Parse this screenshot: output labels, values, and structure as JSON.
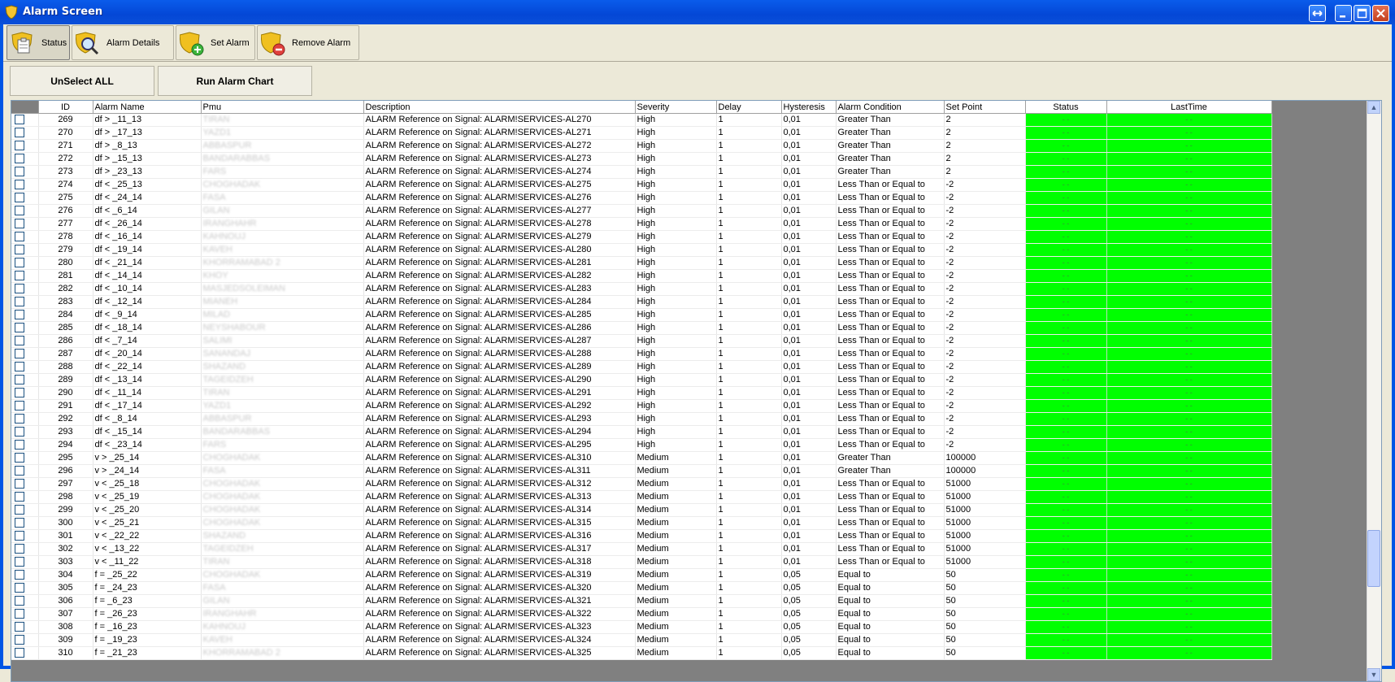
{
  "window": {
    "title": "Alarm Screen"
  },
  "toolbar": {
    "status": "Status",
    "alarm_details": "Alarm Details",
    "set_alarm": "Set Alarm",
    "remove_alarm": "Remove Alarm"
  },
  "buttons": {
    "unselect_all": "UnSelect ALL",
    "run_alarm_chart": "Run Alarm Chart"
  },
  "grid": {
    "columns": {
      "id": "ID",
      "alarm_name": "Alarm Name",
      "pmu": "Pmu",
      "description": "Description",
      "severity": "Severity",
      "delay": "Delay",
      "hysteresis": "Hysteresis",
      "alarm_condition": "Alarm Condition",
      "set_point": "Set Point",
      "status": "Status",
      "last_time": "LastTime"
    },
    "status_color": "#00FF00",
    "rows": [
      {
        "id": "269",
        "name": "df > _11_13",
        "pmu": "TIRAN",
        "desc": "ALARM Reference on Signal: ALARM!SERVICES-AL270",
        "sev": "High",
        "delay": "1",
        "hyst": "0,01",
        "cond": "Greater Than",
        "sp": "2",
        "status": "- -",
        "last": "- -"
      },
      {
        "id": "270",
        "name": "df > _17_13",
        "pmu": "YAZD1",
        "desc": "ALARM Reference on Signal: ALARM!SERVICES-AL271",
        "sev": "High",
        "delay": "1",
        "hyst": "0,01",
        "cond": "Greater Than",
        "sp": "2",
        "status": "- -",
        "last": "- -"
      },
      {
        "id": "271",
        "name": "df > _8_13",
        "pmu": "ABBASPUR",
        "desc": "ALARM Reference on Signal: ALARM!SERVICES-AL272",
        "sev": "High",
        "delay": "1",
        "hyst": "0,01",
        "cond": "Greater Than",
        "sp": "2",
        "status": "- -",
        "last": "- -"
      },
      {
        "id": "272",
        "name": "df > _15_13",
        "pmu": "BANDARABBAS",
        "desc": "ALARM Reference on Signal: ALARM!SERVICES-AL273",
        "sev": "High",
        "delay": "1",
        "hyst": "0,01",
        "cond": "Greater Than",
        "sp": "2",
        "status": "- -",
        "last": "- -"
      },
      {
        "id": "273",
        "name": "df > _23_13",
        "pmu": "FARS",
        "desc": "ALARM Reference on Signal: ALARM!SERVICES-AL274",
        "sev": "High",
        "delay": "1",
        "hyst": "0,01",
        "cond": "Greater Than",
        "sp": "2",
        "status": "- -",
        "last": "- -"
      },
      {
        "id": "274",
        "name": "df < _25_13",
        "pmu": "CHOGHADAK",
        "desc": "ALARM Reference on Signal: ALARM!SERVICES-AL275",
        "sev": "High",
        "delay": "1",
        "hyst": "0,01",
        "cond": "Less Than or Equal to",
        "sp": "-2",
        "status": "- -",
        "last": "- -"
      },
      {
        "id": "275",
        "name": "df < _24_14",
        "pmu": "FASA",
        "desc": "ALARM Reference on Signal: ALARM!SERVICES-AL276",
        "sev": "High",
        "delay": "1",
        "hyst": "0,01",
        "cond": "Less Than or Equal to",
        "sp": "-2",
        "status": "- -",
        "last": "- -"
      },
      {
        "id": "276",
        "name": "df < _6_14",
        "pmu": "GILAN",
        "desc": "ALARM Reference on Signal: ALARM!SERVICES-AL277",
        "sev": "High",
        "delay": "1",
        "hyst": "0,01",
        "cond": "Less Than or Equal to",
        "sp": "-2",
        "status": "- -",
        "last": "- -"
      },
      {
        "id": "277",
        "name": "df < _26_14",
        "pmu": "IRANGHAHR",
        "desc": "ALARM Reference on Signal: ALARM!SERVICES-AL278",
        "sev": "High",
        "delay": "1",
        "hyst": "0,01",
        "cond": "Less Than or Equal to",
        "sp": "-2",
        "status": "- -",
        "last": "- -"
      },
      {
        "id": "278",
        "name": "df < _16_14",
        "pmu": "KAHNOUJ",
        "desc": "ALARM Reference on Signal: ALARM!SERVICES-AL279",
        "sev": "High",
        "delay": "1",
        "hyst": "0,01",
        "cond": "Less Than or Equal to",
        "sp": "-2",
        "status": "- -",
        "last": "- -"
      },
      {
        "id": "279",
        "name": "df < _19_14",
        "pmu": "KAVEH",
        "desc": "ALARM Reference on Signal: ALARM!SERVICES-AL280",
        "sev": "High",
        "delay": "1",
        "hyst": "0,01",
        "cond": "Less Than or Equal to",
        "sp": "-2",
        "status": "- -",
        "last": "- -"
      },
      {
        "id": "280",
        "name": "df < _21_14",
        "pmu": "KHORRAMABAD 2",
        "desc": "ALARM Reference on Signal: ALARM!SERVICES-AL281",
        "sev": "High",
        "delay": "1",
        "hyst": "0,01",
        "cond": "Less Than or Equal to",
        "sp": "-2",
        "status": "- -",
        "last": "- -"
      },
      {
        "id": "281",
        "name": "df < _14_14",
        "pmu": "KHOY",
        "desc": "ALARM Reference on Signal: ALARM!SERVICES-AL282",
        "sev": "High",
        "delay": "1",
        "hyst": "0,01",
        "cond": "Less Than or Equal to",
        "sp": "-2",
        "status": "- -",
        "last": "- -"
      },
      {
        "id": "282",
        "name": "df < _10_14",
        "pmu": "MASJEDSOLEIMAN",
        "desc": "ALARM Reference on Signal: ALARM!SERVICES-AL283",
        "sev": "High",
        "delay": "1",
        "hyst": "0,01",
        "cond": "Less Than or Equal to",
        "sp": "-2",
        "status": "- -",
        "last": "- -"
      },
      {
        "id": "283",
        "name": "df < _12_14",
        "pmu": "MIANEH",
        "desc": "ALARM Reference on Signal: ALARM!SERVICES-AL284",
        "sev": "High",
        "delay": "1",
        "hyst": "0,01",
        "cond": "Less Than or Equal to",
        "sp": "-2",
        "status": "- -",
        "last": "- -"
      },
      {
        "id": "284",
        "name": "df < _9_14",
        "pmu": "MILAD",
        "desc": "ALARM Reference on Signal: ALARM!SERVICES-AL285",
        "sev": "High",
        "delay": "1",
        "hyst": "0,01",
        "cond": "Less Than or Equal to",
        "sp": "-2",
        "status": "- -",
        "last": "- -"
      },
      {
        "id": "285",
        "name": "df < _18_14",
        "pmu": "NEYSHABOUR",
        "desc": "ALARM Reference on Signal: ALARM!SERVICES-AL286",
        "sev": "High",
        "delay": "1",
        "hyst": "0,01",
        "cond": "Less Than or Equal to",
        "sp": "-2",
        "status": "- -",
        "last": "- -"
      },
      {
        "id": "286",
        "name": "df < _7_14",
        "pmu": "SALIMI",
        "desc": "ALARM Reference on Signal: ALARM!SERVICES-AL287",
        "sev": "High",
        "delay": "1",
        "hyst": "0,01",
        "cond": "Less Than or Equal to",
        "sp": "-2",
        "status": "- -",
        "last": "- -"
      },
      {
        "id": "287",
        "name": "df < _20_14",
        "pmu": "SANANDAJ",
        "desc": "ALARM Reference on Signal: ALARM!SERVICES-AL288",
        "sev": "High",
        "delay": "1",
        "hyst": "0,01",
        "cond": "Less Than or Equal to",
        "sp": "-2",
        "status": "- -",
        "last": "- -"
      },
      {
        "id": "288",
        "name": "df < _22_14",
        "pmu": "SHAZAND",
        "desc": "ALARM Reference on Signal: ALARM!SERVICES-AL289",
        "sev": "High",
        "delay": "1",
        "hyst": "0,01",
        "cond": "Less Than or Equal to",
        "sp": "-2",
        "status": "- -",
        "last": "- -"
      },
      {
        "id": "289",
        "name": "df < _13_14",
        "pmu": "TAGEIDZEH",
        "desc": "ALARM Reference on Signal: ALARM!SERVICES-AL290",
        "sev": "High",
        "delay": "1",
        "hyst": "0,01",
        "cond": "Less Than or Equal to",
        "sp": "-2",
        "status": "- -",
        "last": "- -"
      },
      {
        "id": "290",
        "name": "df < _11_14",
        "pmu": "TIRAN",
        "desc": "ALARM Reference on Signal: ALARM!SERVICES-AL291",
        "sev": "High",
        "delay": "1",
        "hyst": "0,01",
        "cond": "Less Than or Equal to",
        "sp": "-2",
        "status": "- -",
        "last": "- -"
      },
      {
        "id": "291",
        "name": "df < _17_14",
        "pmu": "YAZD1",
        "desc": "ALARM Reference on Signal: ALARM!SERVICES-AL292",
        "sev": "High",
        "delay": "1",
        "hyst": "0,01",
        "cond": "Less Than or Equal to",
        "sp": "-2",
        "status": "- -",
        "last": "- -"
      },
      {
        "id": "292",
        "name": "df < _8_14",
        "pmu": "ABBASPUR",
        "desc": "ALARM Reference on Signal: ALARM!SERVICES-AL293",
        "sev": "High",
        "delay": "1",
        "hyst": "0,01",
        "cond": "Less Than or Equal to",
        "sp": "-2",
        "status": "- -",
        "last": "- -"
      },
      {
        "id": "293",
        "name": "df < _15_14",
        "pmu": "BANDARABBAS",
        "desc": "ALARM Reference on Signal: ALARM!SERVICES-AL294",
        "sev": "High",
        "delay": "1",
        "hyst": "0,01",
        "cond": "Less Than or Equal to",
        "sp": "-2",
        "status": "- -",
        "last": "- -"
      },
      {
        "id": "294",
        "name": "df < _23_14",
        "pmu": "FARS",
        "desc": "ALARM Reference on Signal: ALARM!SERVICES-AL295",
        "sev": "High",
        "delay": "1",
        "hyst": "0,01",
        "cond": "Less Than or Equal to",
        "sp": "-2",
        "status": "- -",
        "last": "- -"
      },
      {
        "id": "295",
        "name": "v > _25_14",
        "pmu": "CHOGHADAK",
        "desc": "ALARM Reference on Signal: ALARM!SERVICES-AL310",
        "sev": "Medium",
        "delay": "1",
        "hyst": "0,01",
        "cond": "Greater Than",
        "sp": "100000",
        "status": "- -",
        "last": "- -"
      },
      {
        "id": "296",
        "name": "v > _24_14",
        "pmu": "FASA",
        "desc": "ALARM Reference on Signal: ALARM!SERVICES-AL311",
        "sev": "Medium",
        "delay": "1",
        "hyst": "0,01",
        "cond": "Greater Than",
        "sp": "100000",
        "status": "- -",
        "last": "- -"
      },
      {
        "id": "297",
        "name": "v < _25_18",
        "pmu": "CHOGHADAK",
        "desc": "ALARM Reference on Signal: ALARM!SERVICES-AL312",
        "sev": "Medium",
        "delay": "1",
        "hyst": "0,01",
        "cond": "Less Than or Equal to",
        "sp": "51000",
        "status": "- -",
        "last": "- -"
      },
      {
        "id": "298",
        "name": "v < _25_19",
        "pmu": "CHOGHADAK",
        "desc": "ALARM Reference on Signal: ALARM!SERVICES-AL313",
        "sev": "Medium",
        "delay": "1",
        "hyst": "0,01",
        "cond": "Less Than or Equal to",
        "sp": "51000",
        "status": "- -",
        "last": "- -"
      },
      {
        "id": "299",
        "name": "v < _25_20",
        "pmu": "CHOGHADAK",
        "desc": "ALARM Reference on Signal: ALARM!SERVICES-AL314",
        "sev": "Medium",
        "delay": "1",
        "hyst": "0,01",
        "cond": "Less Than or Equal to",
        "sp": "51000",
        "status": "- -",
        "last": "- -"
      },
      {
        "id": "300",
        "name": "v < _25_21",
        "pmu": "CHOGHADAK",
        "desc": "ALARM Reference on Signal: ALARM!SERVICES-AL315",
        "sev": "Medium",
        "delay": "1",
        "hyst": "0,01",
        "cond": "Less Than or Equal to",
        "sp": "51000",
        "status": "- -",
        "last": "- -"
      },
      {
        "id": "301",
        "name": "v < _22_22",
        "pmu": "SHAZAND",
        "desc": "ALARM Reference on Signal: ALARM!SERVICES-AL316",
        "sev": "Medium",
        "delay": "1",
        "hyst": "0,01",
        "cond": "Less Than or Equal to",
        "sp": "51000",
        "status": "- -",
        "last": "- -"
      },
      {
        "id": "302",
        "name": "v < _13_22",
        "pmu": "TAGEIDZEH",
        "desc": "ALARM Reference on Signal: ALARM!SERVICES-AL317",
        "sev": "Medium",
        "delay": "1",
        "hyst": "0,01",
        "cond": "Less Than or Equal to",
        "sp": "51000",
        "status": "- -",
        "last": "- -"
      },
      {
        "id": "303",
        "name": "v < _11_22",
        "pmu": "TIRAN",
        "desc": "ALARM Reference on Signal: ALARM!SERVICES-AL318",
        "sev": "Medium",
        "delay": "1",
        "hyst": "0,01",
        "cond": "Less Than or Equal to",
        "sp": "51000",
        "status": "- -",
        "last": "- -"
      },
      {
        "id": "304",
        "name": "f = _25_22",
        "pmu": "CHOGHADAK",
        "desc": "ALARM Reference on Signal: ALARM!SERVICES-AL319",
        "sev": "Medium",
        "delay": "1",
        "hyst": "0,05",
        "cond": "Equal to",
        "sp": "50",
        "status": "- -",
        "last": "- -"
      },
      {
        "id": "305",
        "name": "f = _24_23",
        "pmu": "FASA",
        "desc": "ALARM Reference on Signal: ALARM!SERVICES-AL320",
        "sev": "Medium",
        "delay": "1",
        "hyst": "0,05",
        "cond": "Equal to",
        "sp": "50",
        "status": "- -",
        "last": "- -"
      },
      {
        "id": "306",
        "name": "f = _6_23",
        "pmu": "GILAN",
        "desc": "ALARM Reference on Signal: ALARM!SERVICES-AL321",
        "sev": "Medium",
        "delay": "1",
        "hyst": "0,05",
        "cond": "Equal to",
        "sp": "50",
        "status": "- -",
        "last": "- -"
      },
      {
        "id": "307",
        "name": "f = _26_23",
        "pmu": "IRANGHAHR",
        "desc": "ALARM Reference on Signal: ALARM!SERVICES-AL322",
        "sev": "Medium",
        "delay": "1",
        "hyst": "0,05",
        "cond": "Equal to",
        "sp": "50",
        "status": "- -",
        "last": "- -"
      },
      {
        "id": "308",
        "name": "f = _16_23",
        "pmu": "KAHNOUJ",
        "desc": "ALARM Reference on Signal: ALARM!SERVICES-AL323",
        "sev": "Medium",
        "delay": "1",
        "hyst": "0,05",
        "cond": "Equal to",
        "sp": "50",
        "status": "- -",
        "last": "- -"
      },
      {
        "id": "309",
        "name": "f = _19_23",
        "pmu": "KAVEH",
        "desc": "ALARM Reference on Signal: ALARM!SERVICES-AL324",
        "sev": "Medium",
        "delay": "1",
        "hyst": "0,05",
        "cond": "Equal to",
        "sp": "50",
        "status": "- -",
        "last": "- -"
      },
      {
        "id": "310",
        "name": "f = _21_23",
        "pmu": "KHORRAMABAD 2",
        "desc": "ALARM Reference on Signal: ALARM!SERVICES-AL325",
        "sev": "Medium",
        "delay": "1",
        "hyst": "0,05",
        "cond": "Equal to",
        "sp": "50",
        "status": "- -",
        "last": "- -"
      }
    ]
  }
}
